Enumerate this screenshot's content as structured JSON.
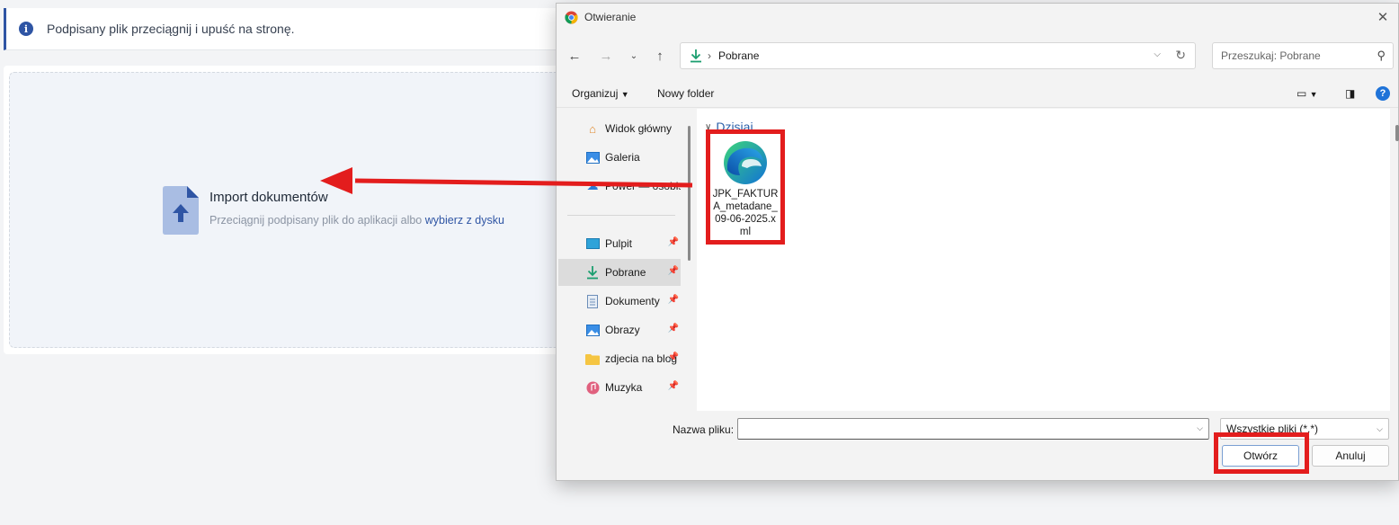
{
  "app": {
    "info_message": "Podpisany plik przeciągnij i upuść na stronę.",
    "import_title": "Import dokumentów",
    "import_sub_prefix": "Przeciągnij podpisany plik do aplikacji albo ",
    "import_link": "wybierz z dysku"
  },
  "dialog": {
    "title": "Otwieranie",
    "address_current": "Pobrane",
    "search_placeholder": "Przeszukaj: Pobrane",
    "toolbar": {
      "organize": "Organizuj",
      "new_folder": "Nowy folder"
    },
    "nav_items": [
      {
        "label": "Widok główny",
        "icon": "home-icon"
      },
      {
        "label": "Galeria",
        "icon": "gallery-icon"
      },
      {
        "label": "Power — osobis",
        "icon": "cloud-icon"
      },
      {
        "label": "Pulpit",
        "icon": "desktop-icon"
      },
      {
        "label": "Pobrane",
        "icon": "download-icon"
      },
      {
        "label": "Dokumenty",
        "icon": "documents-icon"
      },
      {
        "label": "Obrazy",
        "icon": "pictures-icon"
      },
      {
        "label": "zdjecia na blog",
        "icon": "folder-icon"
      },
      {
        "label": "Muzyka",
        "icon": "music-icon"
      }
    ],
    "group_header": "Dzisiaj",
    "file": {
      "name": "JPK_FAKTURA_metadane_09-06-2025.xml",
      "icon": "edge-icon"
    },
    "filename_label": "Nazwa pliku:",
    "filename_value": "",
    "file_type": "Wszystkie pliki (*.*)",
    "open_button": "Otwórz",
    "cancel_button": "Anuluj"
  },
  "colors": {
    "accent": "#2f55a4",
    "annotation_red": "#e31d1d",
    "windows_blue": "#1f73d8"
  }
}
